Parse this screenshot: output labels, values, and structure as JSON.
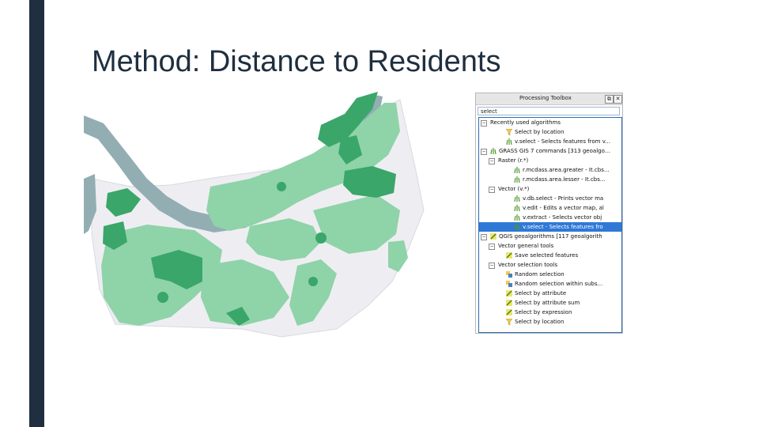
{
  "slide": {
    "title": "Method: Distance to Residents",
    "accent_color": "#1f2f3f"
  },
  "toolbox": {
    "title": "Processing Toolbox",
    "float_button": "⧉",
    "close_button": "✕",
    "search_value": "select",
    "tree": [
      {
        "label": "Recently used algorithms",
        "indent": 0,
        "expander": "−",
        "icon": "none"
      },
      {
        "label": "Select by location",
        "indent": 2,
        "icon": "funnel-icon"
      },
      {
        "label": "v.select - Selects features from v...",
        "indent": 2,
        "icon": "grass-icon"
      },
      {
        "label": "GRASS GIS 7 commands [313 geoalgo...",
        "indent": 0,
        "expander": "−",
        "icon": "grass-icon"
      },
      {
        "label": "Raster (r.*)",
        "indent": 1,
        "expander": "−",
        "icon": "none"
      },
      {
        "label": "r.mcdass.area.greater - It.cbs...",
        "indent": 3,
        "icon": "grass-icon"
      },
      {
        "label": "r.mcdass.area.lesser - It.cbs...",
        "indent": 3,
        "icon": "grass-icon"
      },
      {
        "label": "Vector (v.*)",
        "indent": 1,
        "expander": "−",
        "icon": "none"
      },
      {
        "label": "v.db.select - Prints vector ma",
        "indent": 3,
        "icon": "grass-icon"
      },
      {
        "label": "v.edit - Edits a vector map, al",
        "indent": 3,
        "icon": "grass-icon"
      },
      {
        "label": "v.extract - Selects vector obj",
        "indent": 3,
        "icon": "grass-icon"
      },
      {
        "label": "v.select - Selects features fro",
        "indent": 3,
        "icon": "grass-icon",
        "selected": true
      },
      {
        "label": "QGIS geoalgorithms [117 geoalgorith",
        "indent": 0,
        "expander": "−",
        "icon": "qgis-icon"
      },
      {
        "label": "Vector general tools",
        "indent": 1,
        "expander": "−",
        "icon": "none"
      },
      {
        "label": "Save selected features",
        "indent": 2,
        "icon": "qgis-icon"
      },
      {
        "label": "Vector selection tools",
        "indent": 1,
        "expander": "−",
        "icon": "none"
      },
      {
        "label": "Random selection",
        "indent": 2,
        "icon": "random-icon"
      },
      {
        "label": "Random selection within subs...",
        "indent": 2,
        "icon": "random-icon"
      },
      {
        "label": "Select by attribute",
        "indent": 2,
        "icon": "qgis-icon"
      },
      {
        "label": "Select by attribute sum",
        "indent": 2,
        "icon": "qgis-icon"
      },
      {
        "label": "Select by expression",
        "indent": 2,
        "icon": "qgis-icon"
      },
      {
        "label": "Select by location",
        "indent": 2,
        "icon": "funnel-icon"
      }
    ]
  },
  "map": {
    "water_color": "#93aeb3",
    "light_green": "#8fd3a9",
    "dark_green": "#3aa66a",
    "land_color": "#eeeef2"
  }
}
